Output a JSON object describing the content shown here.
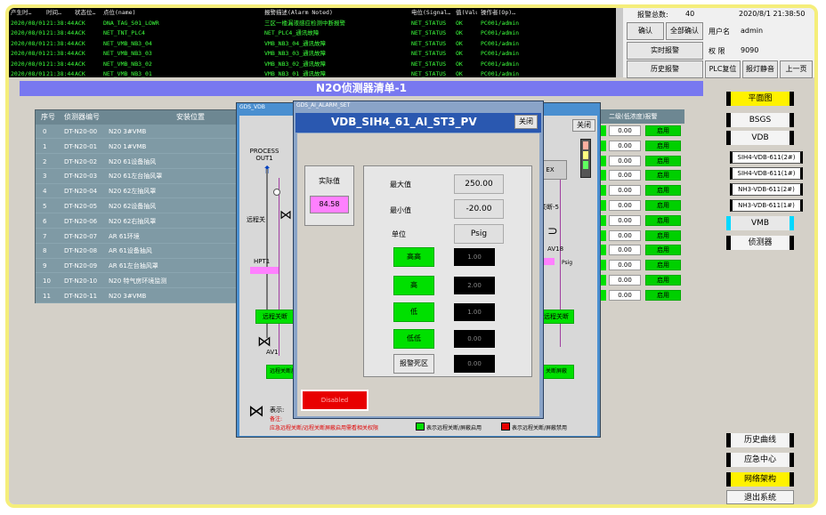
{
  "alarm_banner": {
    "headers": [
      "产生时…",
      "时间…",
      "状态位…",
      "点位(name)",
      "报警描述(Alarm Noted)",
      "电位(Signal…",
      "值(Value)",
      "操作者(Op)…"
    ],
    "rows": [
      [
        "2020/08/01",
        "21:38:44",
        "ACK",
        "DNA_TAG_S01_LOWR",
        "三区一楼漏液感应检测中断报警",
        "NET_STATUS",
        "OK",
        "PC001/admin"
      ],
      [
        "2020/08/01",
        "21:38:44",
        "ACK",
        "NET_TNT_PLC4",
        "NET_PLC4_通讯故障",
        "NET_STATUS",
        "OK",
        "PC001/admin"
      ],
      [
        "2020/08/01",
        "21:38:44",
        "ACK",
        "NET_VMB_NB3_04",
        "VMB_NB3_04_通讯故障",
        "NET_STATUS",
        "OK",
        "PC001/admin"
      ],
      [
        "2020/08/01",
        "21:38:44",
        "ACK",
        "NET_VMB_NB3_03",
        "VMB_NB3_03_通讯故障",
        "NET_STATUS",
        "OK",
        "PC001/admin"
      ],
      [
        "2020/08/01",
        "21:38:44",
        "ACK",
        "NET_VMB_NB3_02",
        "VMB_NB3_02_通讯故障",
        "NET_STATUS",
        "OK",
        "PC001/admin"
      ],
      [
        "2020/08/01",
        "21:38:44",
        "ACK",
        "NET_VMB_NB3_01",
        "VMB_NB3_01_通讯故障",
        "NET_STATUS",
        "OK",
        "PC001/admin"
      ]
    ]
  },
  "top_right": {
    "alarm_count_label": "报警总数:",
    "alarm_count": "40",
    "datetime": "2020/8/1  21:38:50",
    "ack_btn": "确认",
    "ack_all_btn": "全部确认",
    "user_label": "用户名",
    "user": "admin",
    "realtime_btn": "实时报警",
    "level_label": "权 限",
    "level": "9090",
    "history_btn": "历史报警",
    "plc_reset_btn": "PLC复位",
    "mute_btn": "报灯静音",
    "prev_btn": "上一页"
  },
  "title": "N2O侦测器清单-1",
  "list": {
    "headers": [
      "序号",
      "侦测器编号",
      "安装位置"
    ],
    "rows": [
      [
        "0",
        "DT-N20-00",
        "N20 3#VMB"
      ],
      [
        "1",
        "DT-N20-01",
        "N20 1#VMB"
      ],
      [
        "2",
        "DT-N20-02",
        "N20 61设备抽风"
      ],
      [
        "3",
        "DT-N20-03",
        "N20 61左台抽风罩"
      ],
      [
        "4",
        "DT-N20-04",
        "N20 62左抽风罩"
      ],
      [
        "5",
        "DT-N20-05",
        "N20 62设备抽风"
      ],
      [
        "6",
        "DT-N20-06",
        "N20 62右抽风罩"
      ],
      [
        "7",
        "DT-N20-07",
        "AR 61环境"
      ],
      [
        "8",
        "DT-N20-08",
        "AR 61设备抽风"
      ],
      [
        "9",
        "DT-N20-09",
        "AR 61左台抽风罩"
      ],
      [
        "10",
        "DT-N20-10",
        "N20 特气房环境监测"
      ],
      [
        "11",
        "DT-N20-11",
        "N20 3#VMB"
      ]
    ]
  },
  "detail_header": "二级(低浓度)报警",
  "detail_rows": [
    {
      "value": "0.00",
      "btn": "启用"
    },
    {
      "value": "0.00",
      "btn": "启用"
    },
    {
      "value": "0.00",
      "btn": "启用"
    },
    {
      "value": "0.00",
      "btn": "启用"
    },
    {
      "value": "0.00",
      "btn": "启用"
    },
    {
      "value": "0.00",
      "btn": "启用"
    },
    {
      "value": "0.00",
      "btn": "启用"
    },
    {
      "value": "0.00",
      "btn": "启用"
    },
    {
      "value": "0.00",
      "btn": "启用"
    },
    {
      "value": "0.00",
      "btn": "启用"
    },
    {
      "value": "0.00",
      "btn": "启用"
    },
    {
      "value": "0.00",
      "btn": "启用"
    }
  ],
  "gds": {
    "window_title": "GDS_VDB",
    "close": "关闭",
    "process_label": "PROCESS OUT1",
    "remote_label": "远程关",
    "remote_label_r": "关断-5",
    "hpt_label": "HPT1",
    "av1": "AV1",
    "av18": "AV18",
    "ex": "EX",
    "psig": "Psig",
    "disable_btn_l": "远程关断",
    "disable_btn_r": "远程关断",
    "shield_l": "远程关断屏蔽",
    "shield_r": "关断屏蔽",
    "legend_title": "表示:",
    "legend_note": "备注:",
    "legend_text": "应急远程关断/远程关断屏蔽启用需看相关权限",
    "legend_green": "表示远程关断/屏蔽启用",
    "legend_red": "表示远程关断/屏蔽禁用"
  },
  "popup": {
    "window_title": "GDS_AI_ALARM_SET",
    "tag": "VDB_SIH4_61_AI_ST3_PV",
    "close": "关闭",
    "actual_label": "实际值",
    "actual_value": "84.58",
    "max_label": "最大值",
    "max_value": "250.00",
    "min_label": "最小值",
    "min_value": "-20.00",
    "unit_label": "单位",
    "unit_value": "Psig",
    "hh_label": "高高",
    "hh_value": "1.00",
    "h_label": "高",
    "h_value": "2.00",
    "l_label": "低",
    "l_value": "1.00",
    "ll_label": "低低",
    "ll_value": "0.00",
    "deadband_label": "报警死区",
    "deadband_value": "0.00",
    "disabled_btn": "Disabled"
  },
  "nav": {
    "plan": "平面图",
    "bsgs": "BSGS",
    "vdb": "VDB",
    "sub": [
      "SIH4-VDB-611(2#)",
      "SIH4-VDB-611(1#)",
      "NH3-VDB-611(2#)",
      "NH3-VDB-611(1#)"
    ],
    "vmb": "VMB",
    "detector": "侦测器",
    "history": "历史曲线",
    "emergency": "应急中心",
    "network": "网络架构",
    "exit": "退出系统"
  },
  "colors": {
    "title_bar": "#7878f0",
    "alarm_text": "#3cff3c",
    "enable_green": "#00e000",
    "disabled_red": "#e80000",
    "highlight_yellow": "#fff200"
  }
}
